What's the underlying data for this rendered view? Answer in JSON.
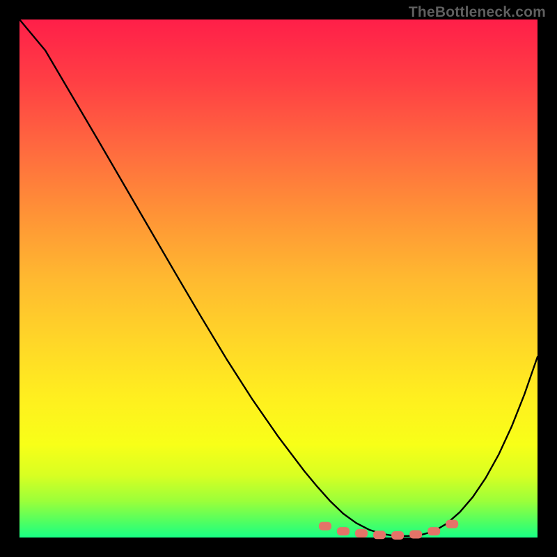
{
  "watermark": "TheBottleneck.com",
  "chart_data": {
    "type": "line",
    "title": "",
    "xlabel": "",
    "ylabel": "",
    "xlim": [
      0,
      1
    ],
    "ylim": [
      0,
      1
    ],
    "series": [
      {
        "name": "bottleneck-curve",
        "color": "#000000",
        "x": [
          0.0,
          0.05,
          0.1,
          0.15,
          0.2,
          0.25,
          0.3,
          0.35,
          0.4,
          0.45,
          0.5,
          0.55,
          0.575,
          0.6,
          0.625,
          0.65,
          0.675,
          0.7,
          0.725,
          0.75,
          0.775,
          0.8,
          0.825,
          0.85,
          0.875,
          0.9,
          0.925,
          0.95,
          0.975,
          1.0
        ],
        "y": [
          1.0,
          0.94,
          0.855,
          0.77,
          0.684,
          0.598,
          0.512,
          0.427,
          0.344,
          0.266,
          0.194,
          0.128,
          0.098,
          0.07,
          0.046,
          0.028,
          0.015,
          0.007,
          0.003,
          0.003,
          0.005,
          0.012,
          0.027,
          0.049,
          0.078,
          0.115,
          0.16,
          0.214,
          0.277,
          0.349
        ]
      }
    ],
    "markers": [
      {
        "shape": "rounded-dash",
        "color": "#e57368",
        "x": 0.59,
        "y": 0.022
      },
      {
        "shape": "rounded-dash",
        "color": "#e57368",
        "x": 0.625,
        "y": 0.012
      },
      {
        "shape": "rounded-dash",
        "color": "#e57368",
        "x": 0.66,
        "y": 0.008
      },
      {
        "shape": "rounded-dash",
        "color": "#e57368",
        "x": 0.695,
        "y": 0.005
      },
      {
        "shape": "rounded-dash",
        "color": "#e57368",
        "x": 0.73,
        "y": 0.004
      },
      {
        "shape": "rounded-dash",
        "color": "#e57368",
        "x": 0.765,
        "y": 0.006
      },
      {
        "shape": "rounded-dash",
        "color": "#e57368",
        "x": 0.8,
        "y": 0.012
      },
      {
        "shape": "rounded-dash",
        "color": "#e57368",
        "x": 0.835,
        "y": 0.026
      }
    ],
    "gradient_colors": {
      "top": "#ff1f49",
      "mid": "#ffe028",
      "bottom": "#18ff85"
    }
  }
}
